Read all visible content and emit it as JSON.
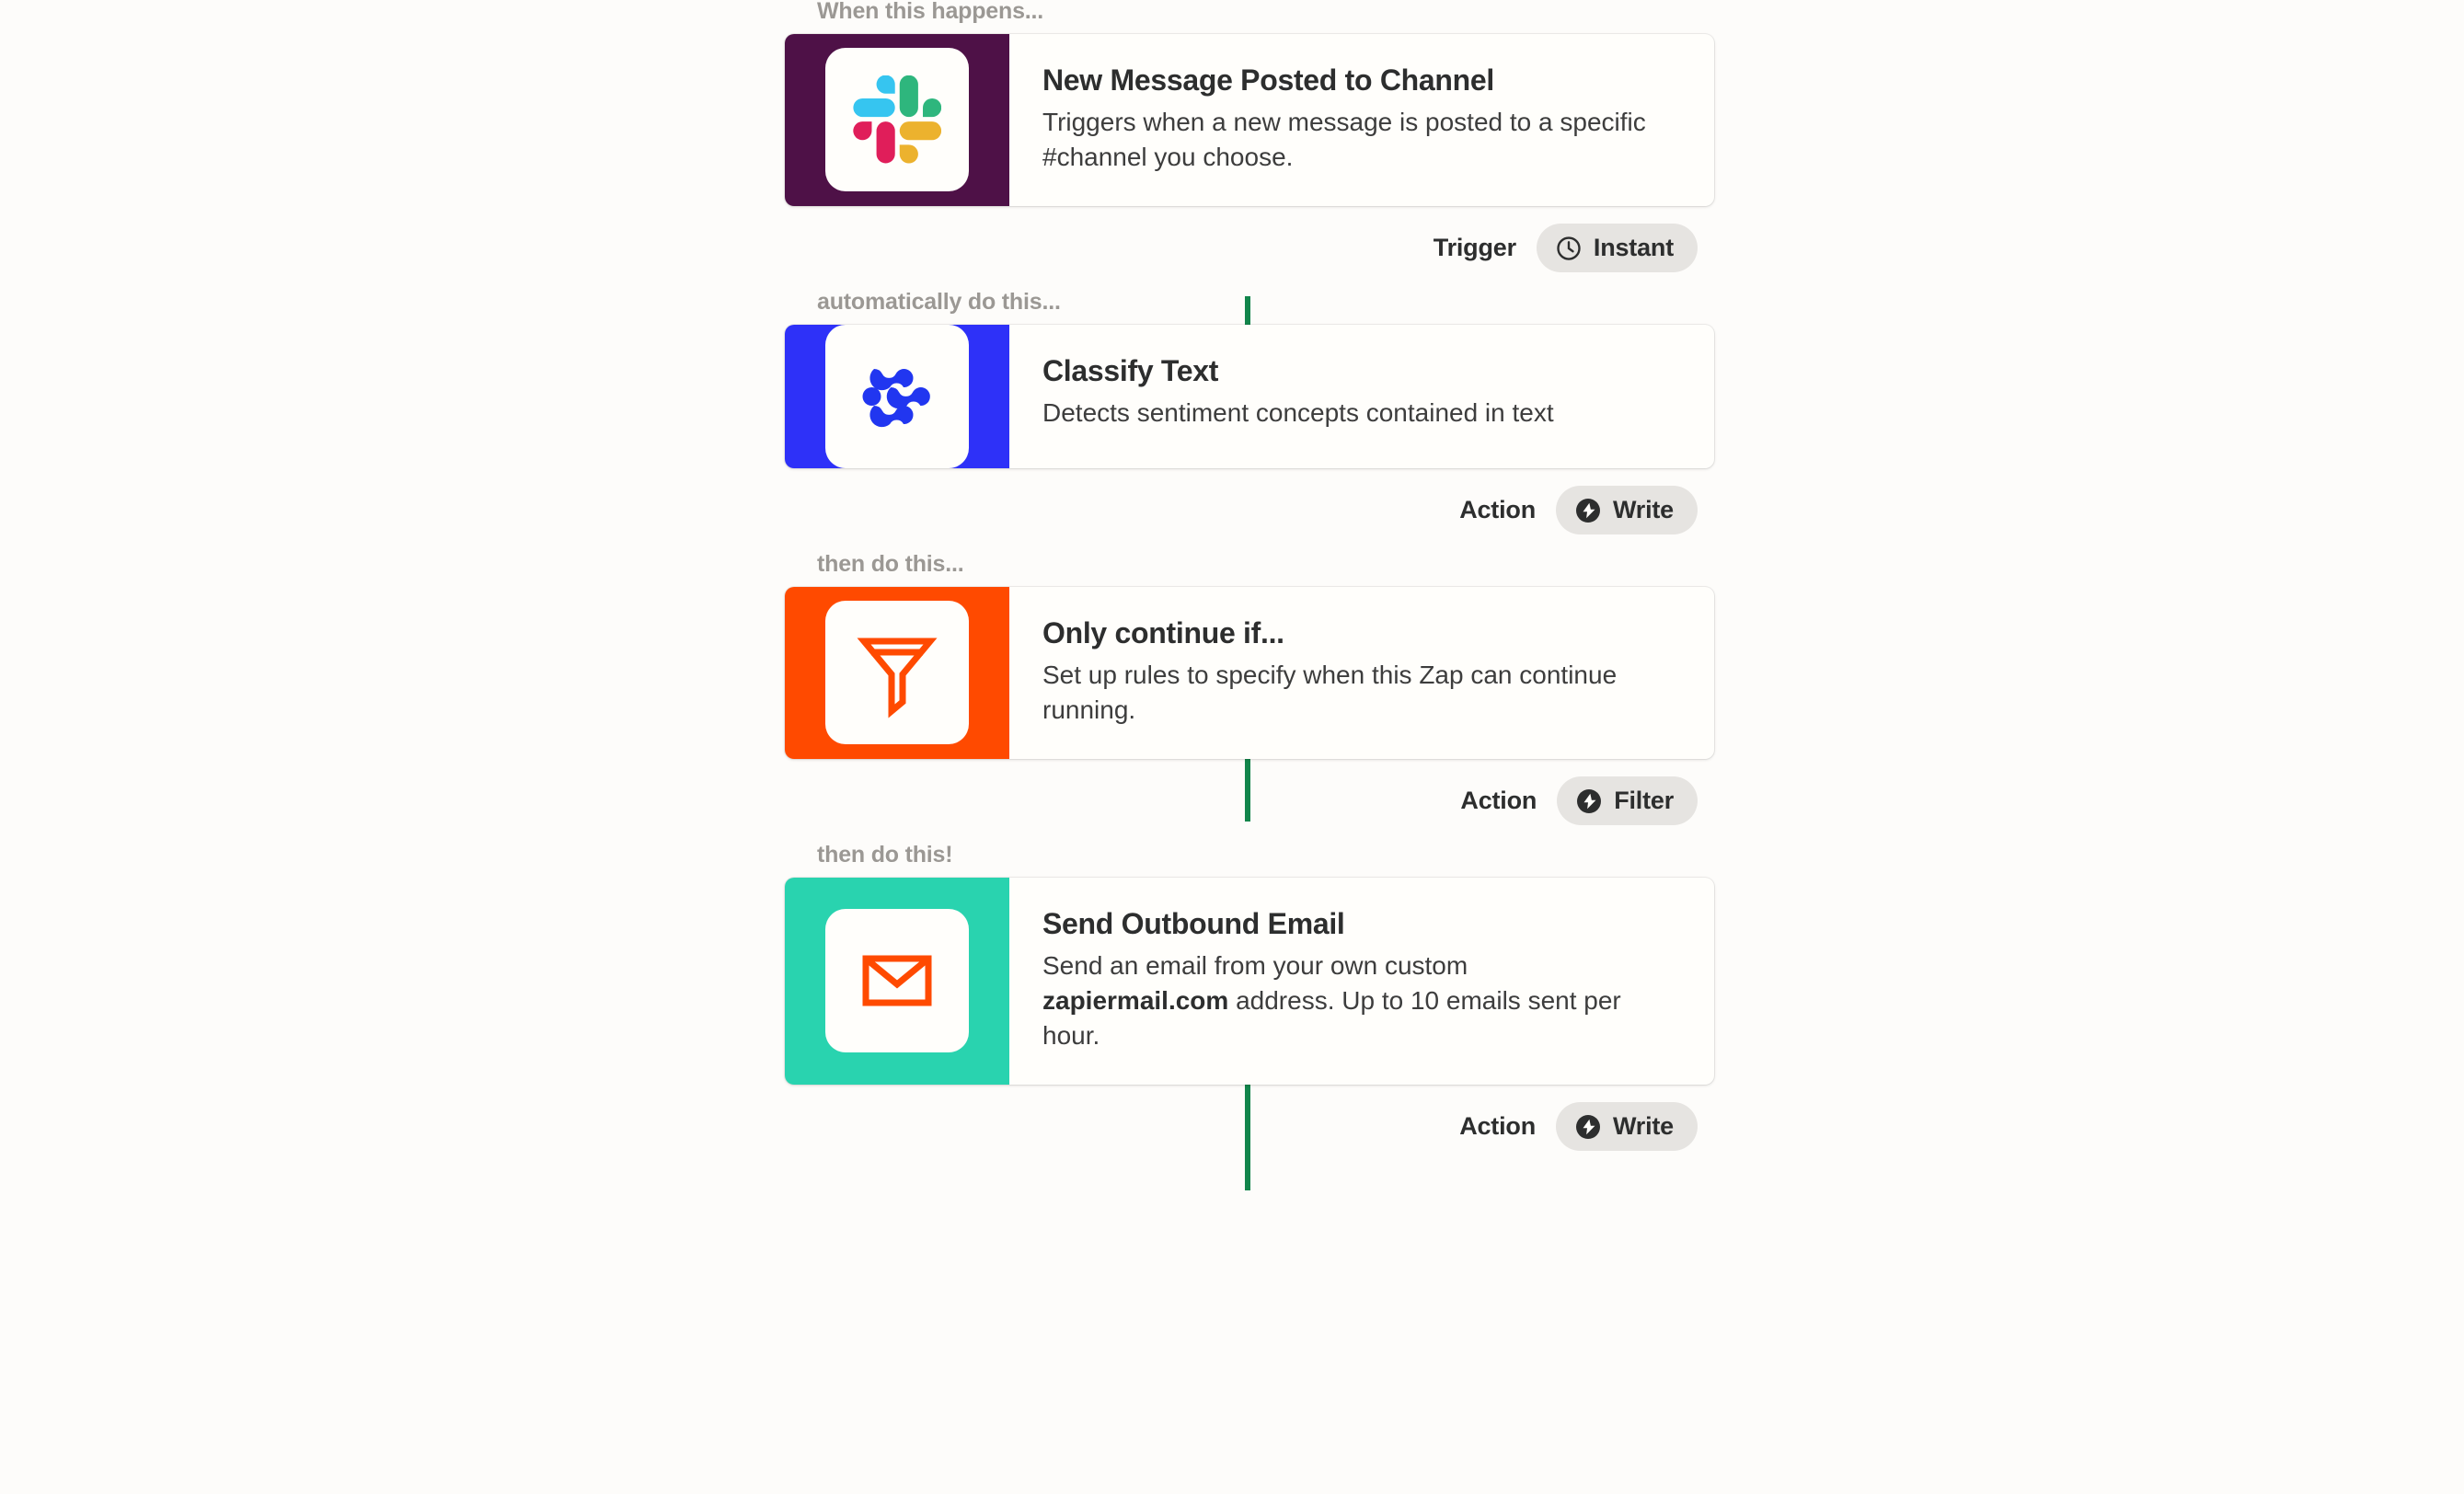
{
  "page": {
    "background_color": "#FDFCFA",
    "connector_color": "#12854B",
    "title": "Zap workflow steps"
  },
  "steps": [
    {
      "step_label": "When this happens...",
      "title": "New Message Posted to Channel",
      "description": "Triggers when a new message is posted to a specific #channel you choose.",
      "app_icon": "slack-icon",
      "art_background": "#4E1147",
      "meta": {
        "kind": "Trigger",
        "pill_label": "Instant",
        "pill_icon": "clock-icon"
      }
    },
    {
      "step_label": "automatically do this...",
      "title": "Classify Text",
      "description": "Detects sentiment concepts contained in text",
      "app_icon": "classify-text-icon",
      "art_background": "#2E31F8",
      "meta": {
        "kind": "Action",
        "pill_label": "Write",
        "pill_icon": "bolt-icon"
      }
    },
    {
      "step_label": "then do this...",
      "title": "Only continue if...",
      "description": "Set up rules to specify when this Zap can continue running.",
      "app_icon": "funnel-filter-icon",
      "art_background": "#FF4A00",
      "meta": {
        "kind": "Action",
        "pill_label": "Filter",
        "pill_icon": "bolt-icon"
      }
    },
    {
      "step_label": "then do this!",
      "title": "Send Outbound Email",
      "description_part_1": "Send an email from your own custom ",
      "description_bold": "zapiermail.com",
      "description_part_2": " address. Up to 10 emails sent per hour.",
      "app_icon": "envelope-icon",
      "art_background": "#29D3AF",
      "meta": {
        "kind": "Action",
        "pill_label": "Write",
        "pill_icon": "bolt-icon"
      }
    }
  ],
  "icon_colors": {
    "slack_blue": "#36C5F0",
    "slack_green": "#2EB67D",
    "slack_red": "#E01E5A",
    "slack_yellow": "#ECB22E",
    "classify_blue": "#2136F0",
    "filter_orange": "#FF4A00",
    "envelope_orange": "#FF4A00"
  }
}
